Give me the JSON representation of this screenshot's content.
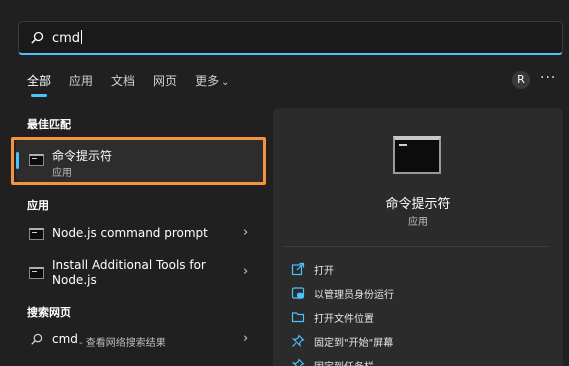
{
  "search": {
    "query": "cmd"
  },
  "tabs": [
    {
      "label": "全部"
    },
    {
      "label": "应用"
    },
    {
      "label": "文档"
    },
    {
      "label": "网页"
    },
    {
      "label": "更多"
    }
  ],
  "account": {
    "initial": "R"
  },
  "more_menu": {
    "label": "···"
  },
  "best_match": {
    "heading": "最佳匹配",
    "title": "命令提示符",
    "subtitle": "应用"
  },
  "apps": {
    "heading": "应用",
    "items": [
      {
        "title": "Node.js command prompt"
      },
      {
        "title_line1": "Install Additional Tools for",
        "title_line2": "Node.js"
      }
    ]
  },
  "web": {
    "heading": "搜索网页",
    "item_query": "cmd",
    "item_suffix": " - 查看网络搜索结果"
  },
  "detail": {
    "title": "命令提示符",
    "subtitle": "应用",
    "actions": [
      {
        "label": "打开",
        "icon": "open-icon"
      },
      {
        "label": "以管理员身份运行",
        "icon": "admin-shield-icon"
      },
      {
        "label": "打开文件位置",
        "icon": "folder-icon"
      },
      {
        "label": "固定到\"开始\"屏幕",
        "icon": "pin-icon"
      },
      {
        "label": "固定到任务栏",
        "icon": "pin-taskbar-icon"
      }
    ]
  },
  "colors": {
    "accent": "#4cc2ff",
    "highlight_outline": "#f5923e",
    "background": "#202020"
  }
}
